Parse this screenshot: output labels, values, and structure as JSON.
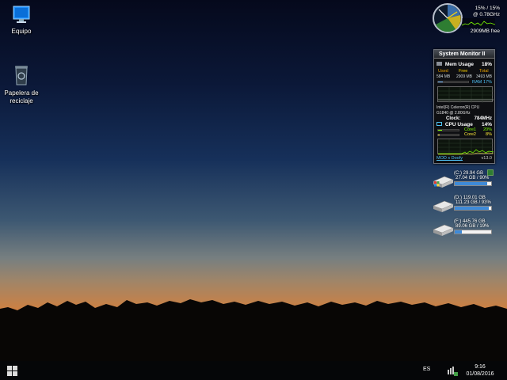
{
  "desktop": {
    "icons": [
      {
        "label": "Equipo",
        "icon": "computer-icon"
      },
      {
        "label": "Papelera de reciclaje",
        "icon": "recycle-bin-icon"
      }
    ]
  },
  "clock_gadget": {
    "cpu_text": "15% / 15%",
    "freq_text": "@ 0.78GHz",
    "mem_free_text": "2909MB free"
  },
  "system_monitor": {
    "title": "System Monitor II",
    "mem_label": "Mem Usage",
    "mem_pct": "18%",
    "mem_cols": [
      "Used",
      "Free",
      "Total"
    ],
    "mem_vals": [
      "584 MB",
      "2909 MB",
      "3493 MB"
    ],
    "ram_label": "RAM",
    "ram_pct": "17%",
    "ram_fraction": 0.17,
    "cpu_name": "Intel(R) Celeron(R) CPU",
    "cpu_model": "G1840 @ 2.80GHz",
    "clock_label": "Clock:",
    "clock_val": "784MHz",
    "cpu_label": "CPU Usage",
    "cpu_pct": "14%",
    "cores": [
      {
        "label": "Core1",
        "pct": "20%",
        "fraction": 0.2
      },
      {
        "label": "Core2",
        "pct": "8%",
        "fraction": 0.08
      }
    ],
    "footer_link": "MOD x Doofy",
    "version": "v13.0"
  },
  "drives": [
    {
      "title": "(C:) 29.94 GB",
      "usage": "27.04 GB / 90%",
      "fraction": 0.9
    },
    {
      "title": "(D:) 119.01 GB",
      "usage": "111.23 GB / 93%",
      "fraction": 0.93
    },
    {
      "title": "(F:) 445.76 GB",
      "usage": "89.06 GB / 19%",
      "fraction": 0.19
    }
  ],
  "taskbar": {
    "language": "ES",
    "time": "9:16",
    "date": "01/08/2016"
  },
  "colors": {
    "accent_blue": "#3e8ad8",
    "mem_used": "#4fc3f7",
    "mem_free": "#ffd600",
    "core_green": "#7cfc00",
    "core_yellow": "#ffeb3b"
  }
}
